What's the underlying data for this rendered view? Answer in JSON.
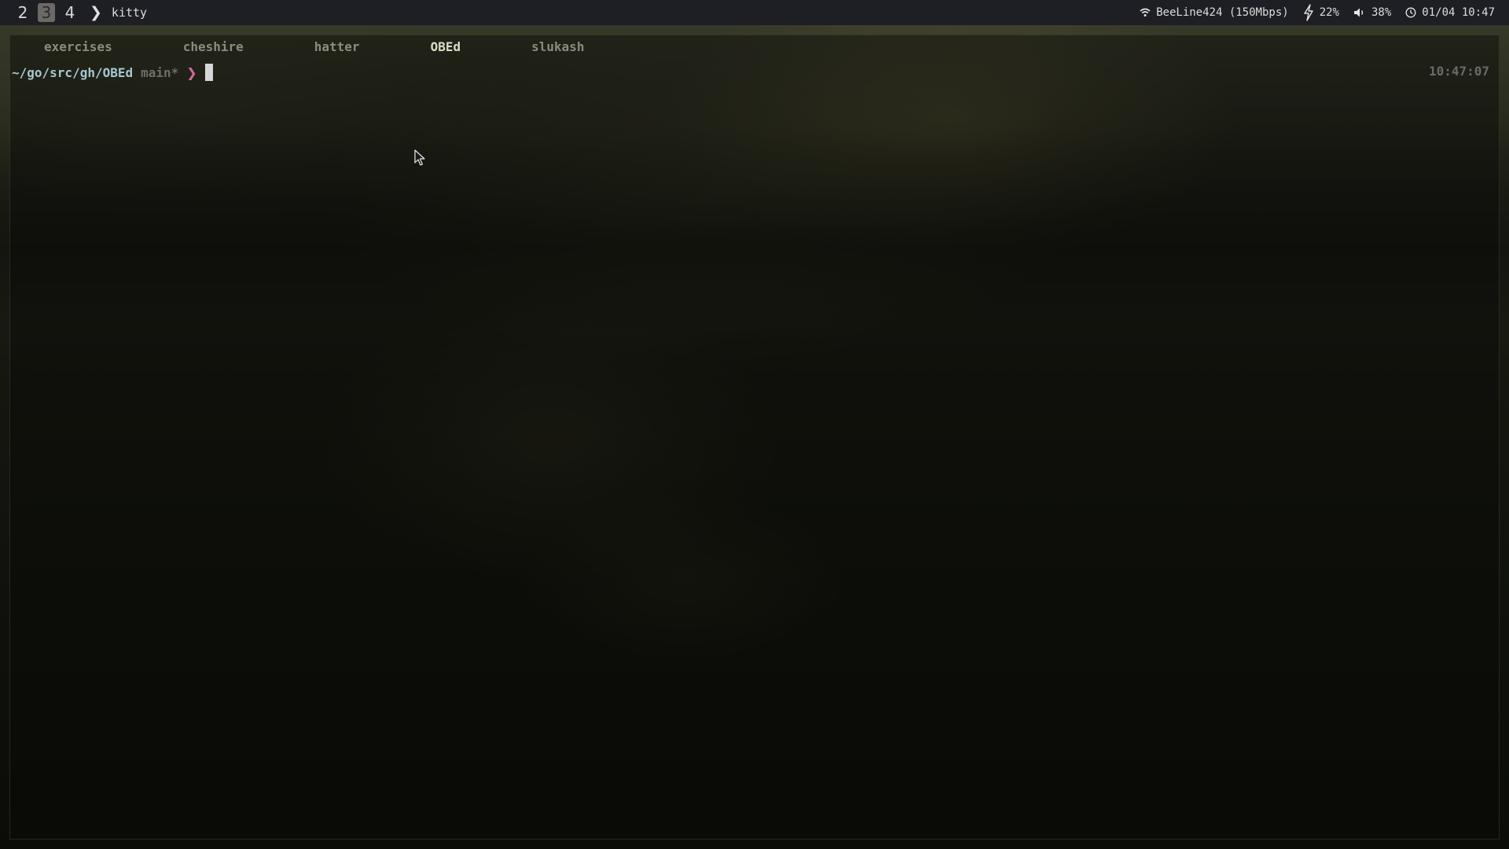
{
  "topbar": {
    "workspaces": [
      {
        "label": "2",
        "active": false
      },
      {
        "label": "3",
        "active": true
      },
      {
        "label": "4",
        "active": false
      }
    ],
    "window_title": "kitty",
    "wifi": {
      "icon": "wifi-icon",
      "label": "BeeLine424 (150Mbps)"
    },
    "battery": {
      "icon": "lightning-icon",
      "label": "22%"
    },
    "volume": {
      "icon": "volume-icon",
      "label": "38%"
    },
    "clock": {
      "icon": "clock-icon",
      "label": "01/04 10:47"
    }
  },
  "terminal": {
    "tabs": [
      {
        "label": "exercises",
        "active": false
      },
      {
        "label": "cheshire",
        "active": false
      },
      {
        "label": "hatter",
        "active": false
      },
      {
        "label": "OBEd",
        "active": true
      },
      {
        "label": "slukash",
        "active": false
      }
    ],
    "prompt": {
      "cwd": "~/go/src/gh/OBEd",
      "branch": "main*",
      "symbol": "❯",
      "right_time": "10:47:07"
    }
  },
  "colors": {
    "bar_bg": "#1d1f24",
    "prompt_cwd": "#a5c7d0",
    "prompt_symbol": "#d76aa2",
    "tab_active": "#dcdbc8",
    "tab_inactive": "#8b8b7e"
  }
}
